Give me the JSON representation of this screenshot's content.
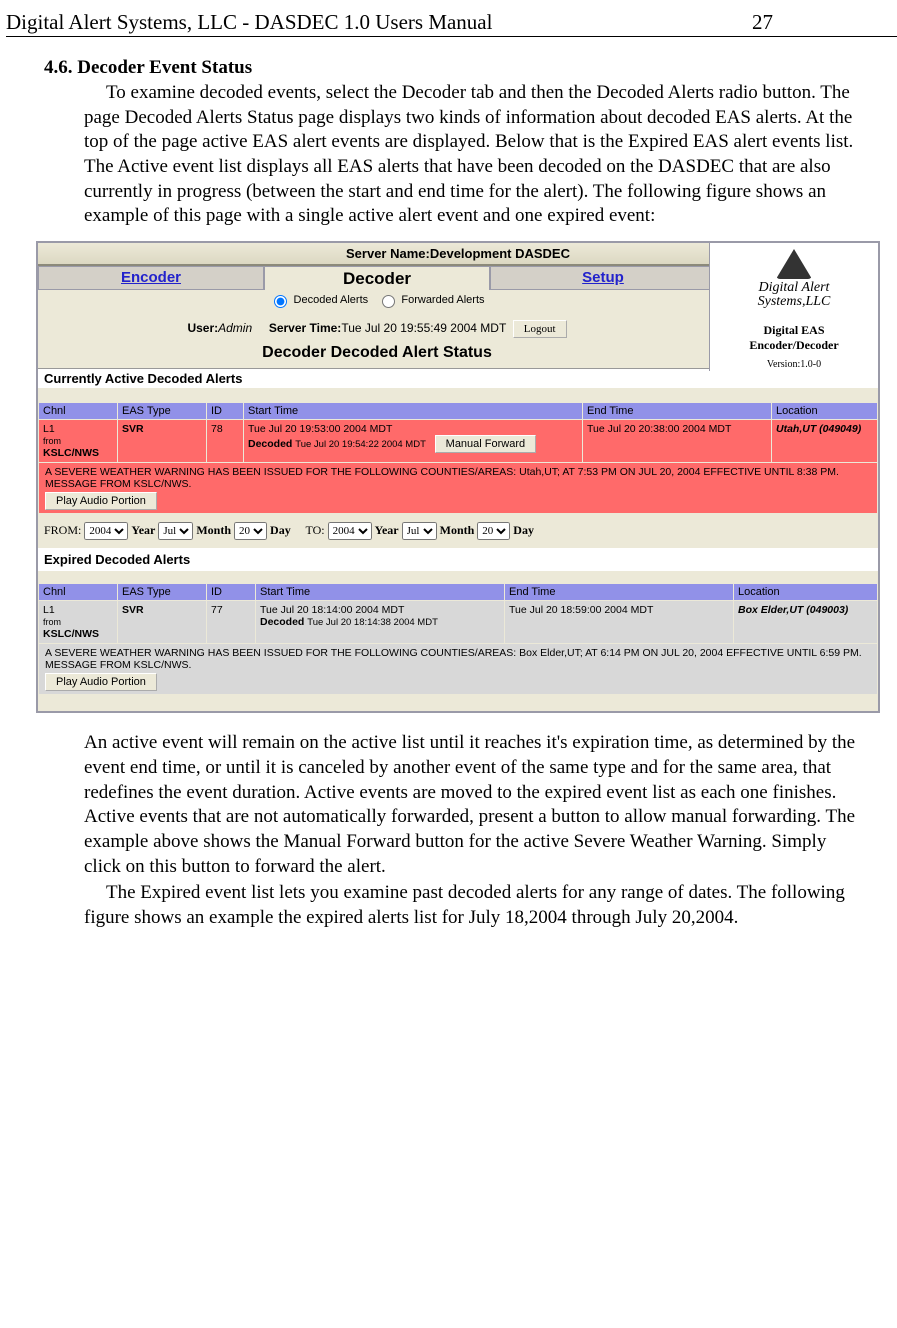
{
  "header": {
    "left": "Digital Alert Systems, LLC - DASDEC 1.0 Users Manual",
    "pagenum": "27"
  },
  "section": {
    "num_title": "4.6. Decoder Event Status",
    "para1": "To examine decoded events, select the Decoder tab and then the Decoded Alerts radio button. The  page  Decoded Alerts Status page displays two kinds of information about decoded EAS alerts. At the top of the page active EAS alert events are displayed. Below that is the Expired EAS alert events list. The Active event list displays all EAS alerts that have been decoded on the DASDEC that are also currently in progress (between the start and end time for the alert).  The following figure shows an example of this page with a single active alert event and one expired event:",
    "para2": "An active event will remain on the active list until it reaches it's expiration time, as determined by the event end time, or until it is canceled by another event of the same type and for the same area, that redefines the event duration. Active events are moved to the expired event list as each one finishes. Active events that are not automatically forwarded, present a button to allow manual forwarding. The example above shows the Manual Forward button for the active Severe Weather Warning. Simply click on this button to forward the alert.",
    "para3": "The Expired event list lets you examine past decoded alerts for any range of dates. The following figure shows an example the expired alerts list for July 18,2004 through July 20,2004."
  },
  "ui": {
    "servername_label": "Server Name:",
    "servername": "Development DASDEC",
    "tabs": {
      "encoder": "Encoder",
      "decoder": "Decoder",
      "setup": "Setup"
    },
    "radios": {
      "decoded": "Decoded Alerts",
      "forwarded": "Forwarded Alerts"
    },
    "logo": {
      "line1": "Digital Alert",
      "line2": "Systems,LLC",
      "prod1": "Digital EAS",
      "prod2": "Encoder/Decoder",
      "version": "Version:1.0-0"
    },
    "userline": {
      "userlabel": "User:",
      "user": "Admin",
      "timelabel": "Server Time:",
      "time": "Tue Jul 20 19:55:49 2004 MDT",
      "logout": "Logout"
    },
    "statusbar": "Decoder Decoded Alert Status",
    "active_header": "Currently Active Decoded Alerts",
    "cols": {
      "chnl": "Chnl",
      "eastype": "EAS Type",
      "id": "ID",
      "start": "Start Time",
      "end": "End Time",
      "loc": "Location"
    },
    "active": {
      "chnl_line1": "L1",
      "chnl_line2": "from",
      "chnl_line3": "KSLC/NWS",
      "eastype": "SVR",
      "id": "78",
      "start_line1": "Tue Jul 20 19:53:00 2004 MDT",
      "decoded_label": "Decoded",
      "start_line2": "Tue Jul 20 19:54:22 2004 MDT",
      "manual_fwd": "Manual Forward",
      "end": "Tue Jul 20 20:38:00 2004 MDT",
      "loc": "Utah,UT (049049)",
      "msg": "A SEVERE WEATHER WARNING HAS BEEN ISSUED FOR THE FOLLOWING COUNTIES/AREAS: Utah,UT; AT 7:53 PM ON JUL 20, 2004 EFFECTIVE UNTIL 8:38 PM. MESSAGE FROM KSLC/NWS.",
      "play": "Play Audio Portion"
    },
    "daterange": {
      "from": "FROM:",
      "to": "TO:",
      "year": "Year",
      "month": "Month",
      "day": "Day",
      "y1": "2004",
      "m1": "Jul",
      "d1": "20",
      "y2": "2004",
      "m2": "Jul",
      "d2": "20"
    },
    "expired_header": "Expired Decoded Alerts",
    "expired": {
      "chnl_line1": "L1",
      "chnl_line2": "from",
      "chnl_line3": "KSLC/NWS",
      "eastype": "SVR",
      "id": "77",
      "start_line1": "Tue Jul 20 18:14:00 2004 MDT",
      "decoded_label": "Decoded",
      "start_line2": "Tue Jul 20 18:14:38 2004 MDT",
      "end": "Tue Jul 20 18:59:00 2004 MDT",
      "loc": "Box Elder,UT (049003)",
      "msg": "A SEVERE WEATHER WARNING HAS BEEN ISSUED FOR THE FOLLOWING COUNTIES/AREAS: Box Elder,UT; AT 6:14 PM ON JUL 20, 2004 EFFECTIVE UNTIL 6:59 PM. MESSAGE FROM KSLC/NWS.",
      "play": "Play Audio Portion"
    }
  }
}
